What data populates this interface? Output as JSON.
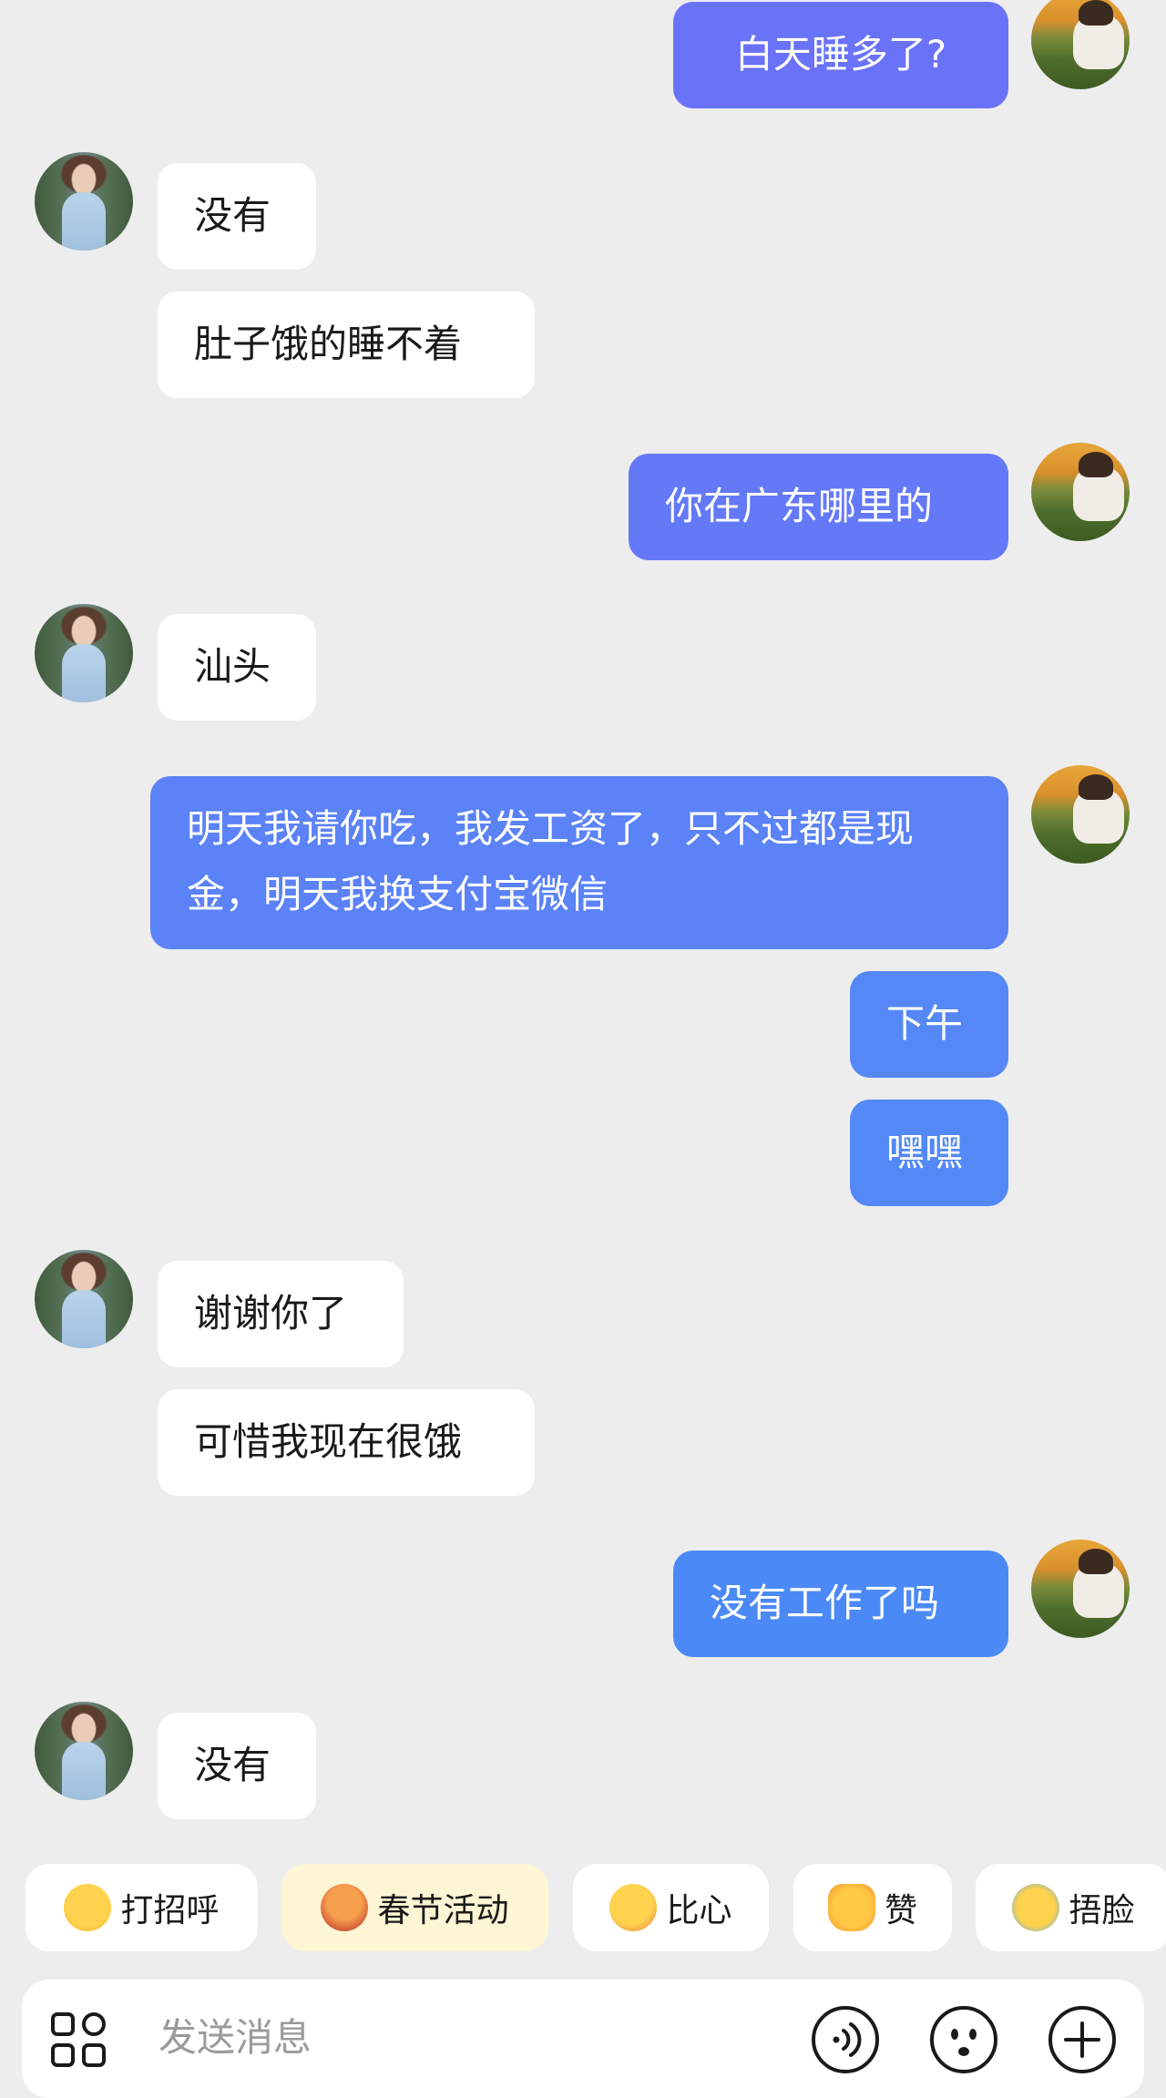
{
  "messages": [
    {
      "side": "out",
      "text": "白天睡多了?"
    },
    {
      "side": "in",
      "text": "没有"
    },
    {
      "side": "in",
      "text": "肚子饿的睡不着"
    },
    {
      "side": "out",
      "text": "你在广东哪里的"
    },
    {
      "side": "in",
      "text": "汕头"
    },
    {
      "side": "out",
      "text": "明天我请你吃，我发工资了，只不过都是现金，明天我换支付宝微信"
    },
    {
      "side": "out",
      "text": "下午"
    },
    {
      "side": "out",
      "text": "嘿嘿"
    },
    {
      "side": "in",
      "text": "谢谢你了"
    },
    {
      "side": "in",
      "text": "可惜我现在很饿"
    },
    {
      "side": "out",
      "text": "没有工作了吗"
    },
    {
      "side": "in",
      "text": "没有"
    }
  ],
  "quick_replies": [
    {
      "label": "打招呼",
      "icon": "wave-emoji-icon",
      "highlight": false
    },
    {
      "label": "春节活动",
      "icon": "tiger-mascot-icon",
      "highlight": true
    },
    {
      "label": "比心",
      "icon": "finger-heart-emoji-icon",
      "highlight": false
    },
    {
      "label": "赞",
      "icon": "thumbs-up-emoji-icon",
      "highlight": false
    },
    {
      "label": "捂脸",
      "icon": "facepalm-emoji-icon",
      "highlight": false
    }
  ],
  "input": {
    "placeholder": "发送消息"
  },
  "colors": {
    "background": "#ededed",
    "incoming_bubble": "#ffffff",
    "outgoing_bubble_top": "#6a74f7",
    "outgoing_bubble_bottom": "#4b8af6",
    "highlight_chip": "#fdf5d4"
  }
}
